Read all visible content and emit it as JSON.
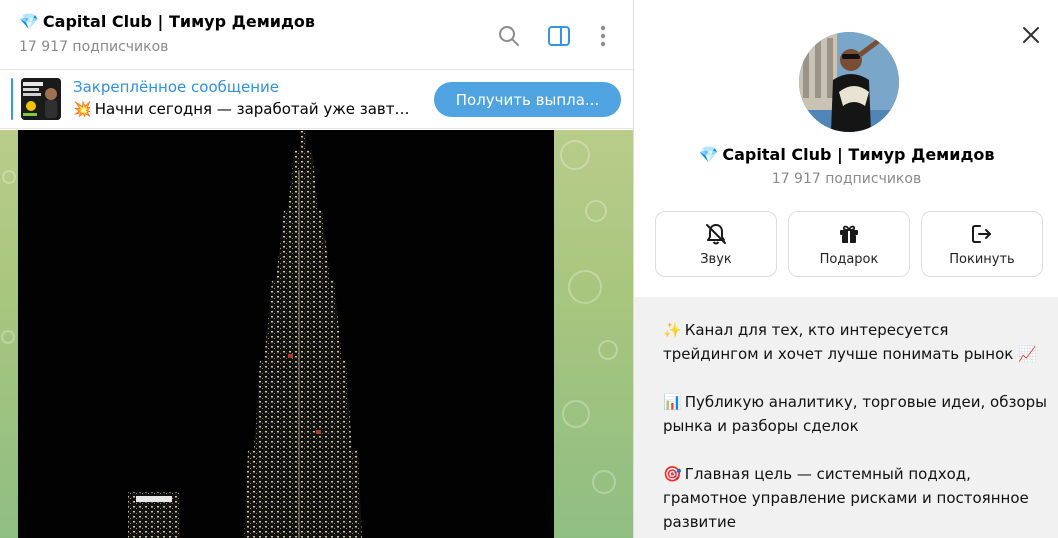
{
  "chat": {
    "title": "Capital Club | Тимур Демидов",
    "title_emoji": "💎",
    "subscribers": "17 917 подписчиков",
    "pinned": {
      "label": "Закреплённое сообщение",
      "emoji": "💥",
      "text": "Начни сегодня — заработай уже завтр...",
      "button_label": "Получить выпла..."
    }
  },
  "info": {
    "name": "Capital Club | Тимур Демидов",
    "name_emoji": "💎",
    "subscribers": "17 917 подписчиков",
    "actions": [
      {
        "label": "Звук",
        "icon": "bell-off-icon"
      },
      {
        "label": "Подарок",
        "icon": "gift-icon"
      },
      {
        "label": "Покинуть",
        "icon": "leave-icon"
      }
    ],
    "description": [
      {
        "emoji": "✨",
        "text": "Канал для тех, кто интересуется трейдингом и хочет лучше понимать рынок",
        "trailing_emoji": "📈"
      },
      {
        "emoji": "📊",
        "text": "Публикую аналитику, торговые идеи, обзоры рынка и разборы сделок",
        "trailing_emoji": ""
      },
      {
        "emoji": "🎯",
        "text": "Главная цель — системный подход, грамотное управление рисками и постоянное развитие",
        "trailing_emoji": ""
      }
    ]
  },
  "colors": {
    "accent": "#3390dd",
    "pin_button": "#4fa3e0",
    "chat_background": "#a8c67e"
  },
  "icons": {
    "search": "search-icon",
    "side_panel": "side-panel-icon",
    "more": "more-vertical-icon",
    "close": "close-icon"
  }
}
